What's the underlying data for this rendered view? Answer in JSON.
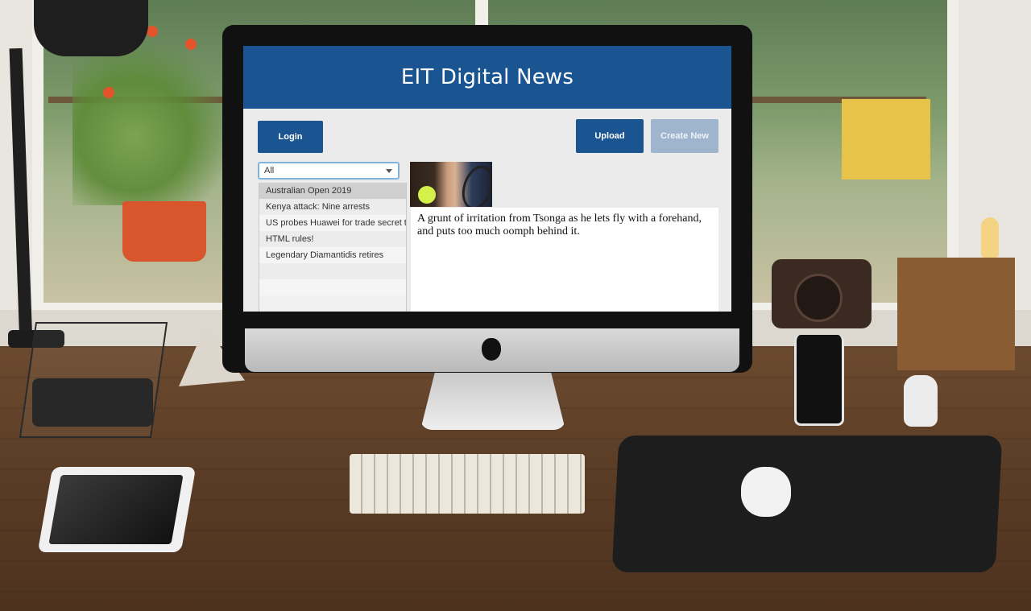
{
  "app": {
    "title": "EIT Digital News"
  },
  "toolbar": {
    "login_label": "Login",
    "upload_label": "Upload",
    "create_label": "Create New"
  },
  "filter": {
    "selected": "All"
  },
  "articles": [
    {
      "title": "Australian Open 2019",
      "selected": true
    },
    {
      "title": "Kenya attack: Nine arrests",
      "selected": false
    },
    {
      "title": "US probes Huawei for trade secret theft",
      "selected": false
    },
    {
      "title": "HTML rules!",
      "selected": false
    },
    {
      "title": "Legendary Diamantidis retires",
      "selected": false
    }
  ],
  "article_view": {
    "body": "A grunt of irritation from Tsonga as he lets fly with a forehand, and puts too much oomph behind it."
  },
  "colors": {
    "brand": "#1a5592",
    "disabled_button": "#9fb5cd",
    "select_border": "#7eb3db"
  }
}
